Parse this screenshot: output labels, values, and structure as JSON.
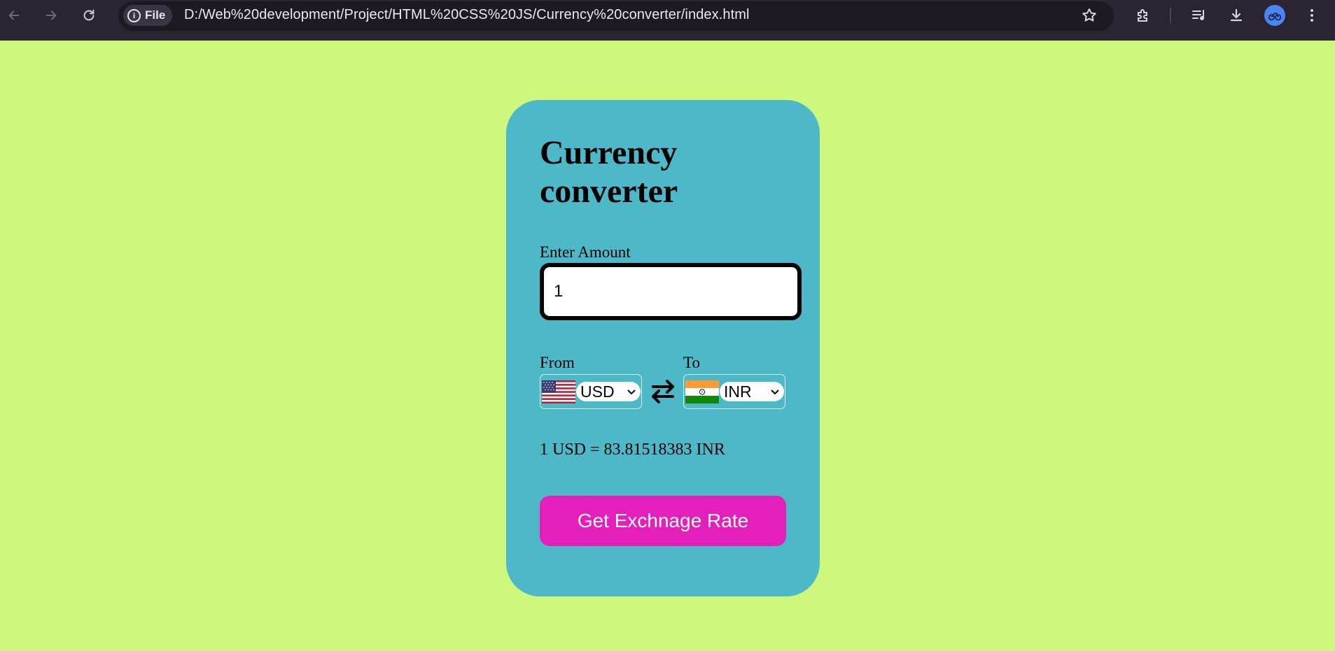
{
  "browser": {
    "chip_label": "File",
    "url": "D:/Web%20development/Project/HTML%20CSS%20JS/Currency%20converter/index.html",
    "icons": [
      "back-icon",
      "forward-icon",
      "reload-icon",
      "info-icon",
      "bookmark-star-icon",
      "extensions-icon",
      "media-queue-icon",
      "download-icon",
      "profile-avatar",
      "menu-kebab-icon"
    ]
  },
  "app": {
    "title": "Currency converter",
    "amount_label": "Enter Amount",
    "amount_value": "1",
    "from_label": "From",
    "to_label": "To",
    "from_currency": "USD",
    "to_currency": "INR",
    "rate_message": "1 USD = 83.81518383 INR",
    "button_label": "Get Exchnage Rate",
    "swap_icon": "swap-arrows-icon"
  },
  "colors": {
    "page_background": "#cef87b",
    "card_background": "#4db8c8",
    "button_background": "#e51fbc",
    "button_text": "#ffffff",
    "chrome_background": "#2b2533"
  }
}
